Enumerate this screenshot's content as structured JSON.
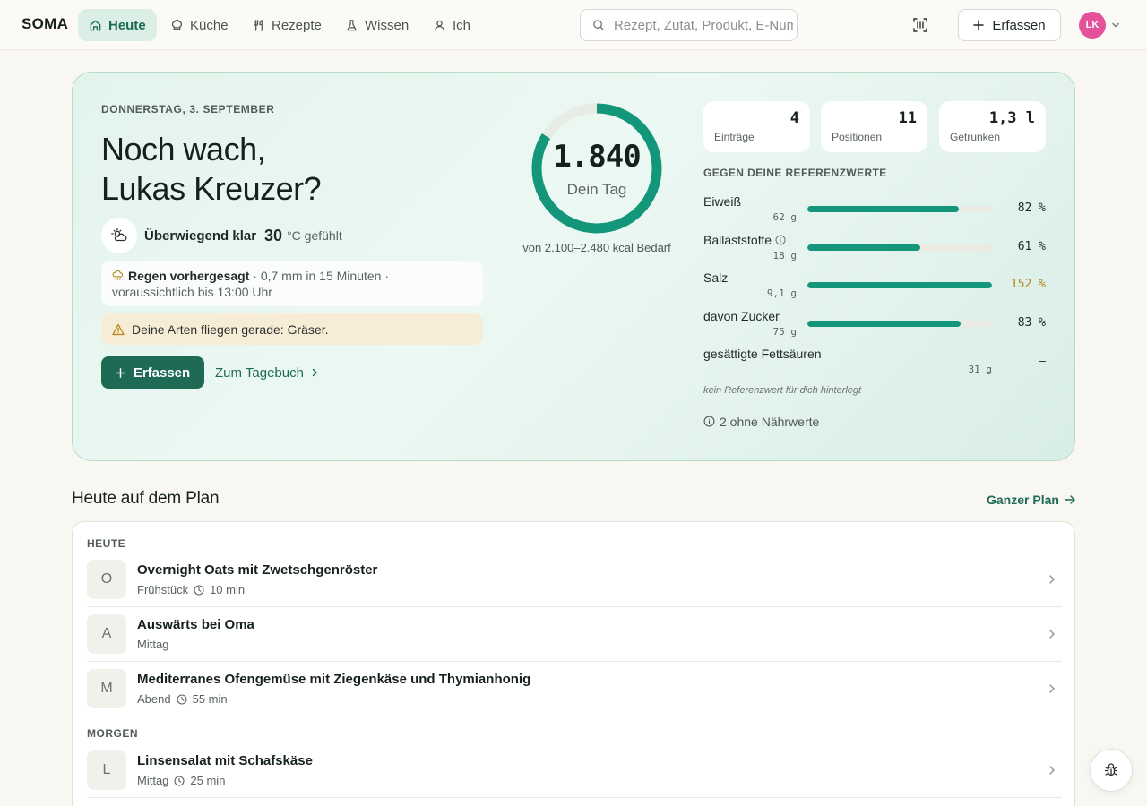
{
  "brand": "SOMA",
  "nav": [
    {
      "label": "Heute",
      "icon": "home-icon",
      "active": true
    },
    {
      "label": "Küche",
      "icon": "chef-hat-icon",
      "active": false
    },
    {
      "label": "Rezepte",
      "icon": "utensils-icon",
      "active": false
    },
    {
      "label": "Wissen",
      "icon": "flask-icon",
      "active": false
    },
    {
      "label": "Ich",
      "icon": "user-icon",
      "active": false
    }
  ],
  "search": {
    "placeholder": "Rezept, Zutat, Produkt, E-Nummer"
  },
  "header": {
    "add_label": "Erfassen",
    "avatar_initials": "LK"
  },
  "hero": {
    "date": "DONNERSTAG, 3. SEPTEMBER",
    "greeting_line1": "Noch wach,",
    "greeting_line2": "Lukas Kreuzer?",
    "weather": {
      "description": "Überwiegend klar",
      "temp": "30",
      "unit": "°C gefühlt"
    },
    "rain": {
      "title": "Regen vorhergesagt",
      "detail": " · 0,7 mm in 15 Minuten · voraussichtlich bis 13:00 Uhr"
    },
    "allergy": "Deine Arten fliegen gerade: Gräser.",
    "primary_button": "Erfassen",
    "link_button": "Zum Tagebuch"
  },
  "ring": {
    "value": "1.840",
    "label": "Dein Tag",
    "subtitle": "von 2.100–2.480 kcal Bedarf",
    "progress": 0.84
  },
  "stats": [
    {
      "value": "4",
      "label": "Einträge"
    },
    {
      "value": "11",
      "label": "Positionen"
    },
    {
      "value": "1,3 l",
      "label": "Getrunken"
    }
  ],
  "reference": {
    "heading": "GEGEN DEINE REFERENZWERTE",
    "items": [
      {
        "name": "Eiweiß",
        "amount": "62 g",
        "percent_label": "82 %",
        "percent": 82,
        "info": false,
        "warn": false
      },
      {
        "name": "Ballaststoffe",
        "amount": "18 g",
        "percent_label": "61 %",
        "percent": 61,
        "info": true,
        "warn": false
      },
      {
        "name": "Salz",
        "amount": "9,1 g",
        "percent_label": "152 %",
        "percent": 152,
        "info": false,
        "warn": true
      },
      {
        "name": "davon Zucker",
        "amount": "75 g",
        "percent_label": "83 %",
        "percent": 83,
        "info": false,
        "warn": false
      }
    ],
    "sat_fat": {
      "name": "gesättigte Fettsäuren",
      "amount": "31 g",
      "percent_label": "–"
    },
    "note": "kein Referenzwert für dich hinterlegt",
    "no_values": "2 ohne Nährwerte"
  },
  "plan": {
    "title": "Heute auf dem Plan",
    "link": "Ganzer Plan",
    "groups": [
      {
        "label": "HEUTE",
        "rows": [
          {
            "initial": "O",
            "title": "Overnight Oats mit Zwetschgenröster",
            "meal": "Frühstück",
            "time": "10 min"
          },
          {
            "initial": "A",
            "title": "Auswärts bei Oma",
            "meal": "Mittag",
            "time": ""
          },
          {
            "initial": "M",
            "title": "Mediterranes Ofengemüse mit Ziegenkäse und Thymianhonig",
            "meal": "Abend",
            "time": "55 min"
          }
        ]
      },
      {
        "label": "MORGEN",
        "rows": [
          {
            "initial": "L",
            "title": "Linsensalat mit Schafskäse",
            "meal": "Mittag",
            "time": "25 min"
          }
        ]
      }
    ]
  },
  "colors": {
    "accent": "#1e6a55",
    "bar": "#13967a",
    "warn": "#b38413",
    "avatar": "#e6519c"
  }
}
